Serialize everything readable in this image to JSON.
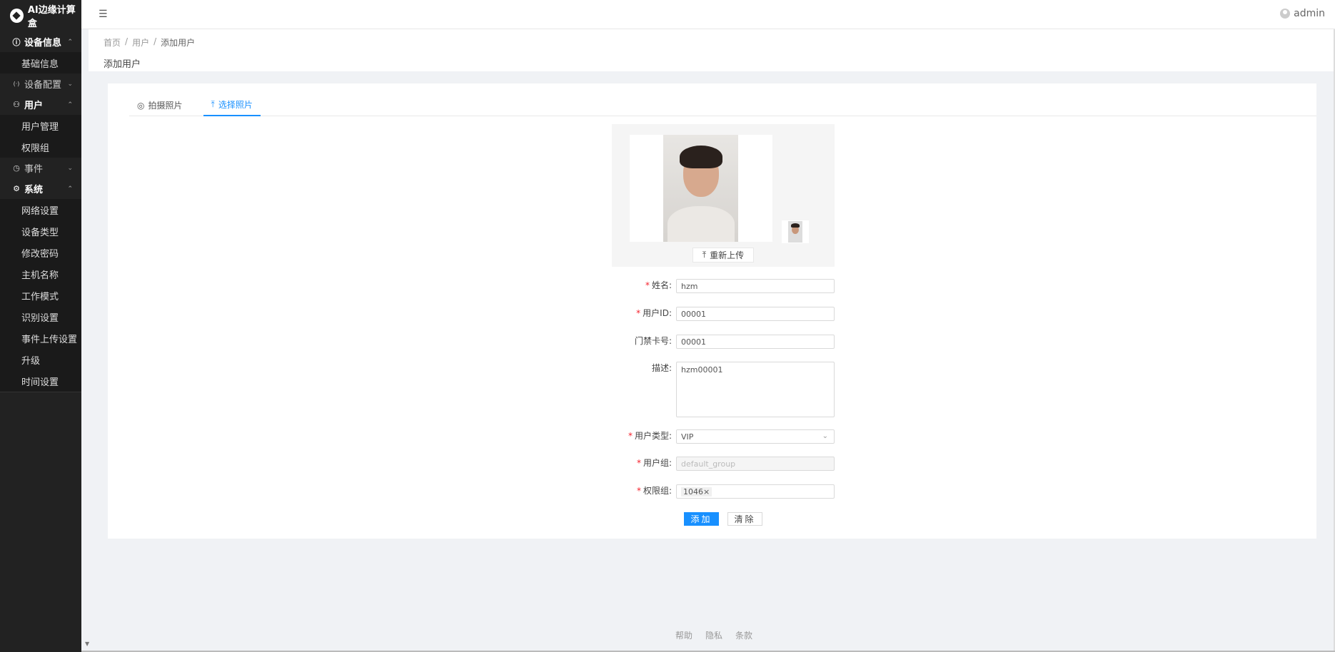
{
  "app": {
    "title": "AI边缘计算盒"
  },
  "sidebar": {
    "groups": [
      {
        "label": "设备信息",
        "icon": "info-circle-icon",
        "glyph": "ⓘ",
        "open": true,
        "items": [
          "基础信息"
        ]
      },
      {
        "label": "设备配置",
        "icon": "broadcast-icon",
        "glyph": "((·))",
        "open": false,
        "items": []
      },
      {
        "label": "用户",
        "icon": "user-icon",
        "glyph": "⚇",
        "open": true,
        "items": [
          "用户管理",
          "权限组"
        ]
      },
      {
        "label": "事件",
        "icon": "clock-icon",
        "glyph": "◷",
        "open": false,
        "items": []
      },
      {
        "label": "系统",
        "icon": "gear-icon",
        "glyph": "⚙",
        "open": true,
        "items": [
          "网络设置",
          "设备类型",
          "修改密码",
          "主机名称",
          "工作模式",
          "识别设置",
          "事件上传设置",
          "升级",
          "时间设置"
        ]
      }
    ]
  },
  "header": {
    "username": "admin"
  },
  "breadcrumb": {
    "items": [
      "首页",
      "用户",
      "添加用户"
    ],
    "separator": "/"
  },
  "page": {
    "title": "添加用户"
  },
  "tabs": {
    "take_photo": "拍摄照片",
    "select_photo": "选择照片"
  },
  "photo": {
    "reupload_label": "重新上传"
  },
  "form": {
    "name": {
      "label": "姓名:",
      "value": "hzm",
      "required": true
    },
    "user_id": {
      "label": "用户ID:",
      "value": "00001",
      "required": true
    },
    "card_no": {
      "label": "门禁卡号:",
      "value": "00001",
      "required": false
    },
    "description": {
      "label": "描述:",
      "value": "hzm00001",
      "required": false
    },
    "user_type": {
      "label": "用户类型:",
      "value": "VIP",
      "required": true
    },
    "user_group": {
      "label": "用户组:",
      "value": "default_group",
      "required": true
    },
    "permission_group": {
      "label": "权限组:",
      "tag": "1046",
      "remove": "×",
      "required": true
    },
    "required_mark": "*"
  },
  "actions": {
    "add_label": "添加",
    "clear_label": "清除"
  },
  "footer": {
    "links": [
      "帮助",
      "隐私",
      "条款"
    ]
  },
  "colors": {
    "primary": "#1890ff",
    "sidebar_bg": "#222222",
    "required": "#f5222d"
  }
}
